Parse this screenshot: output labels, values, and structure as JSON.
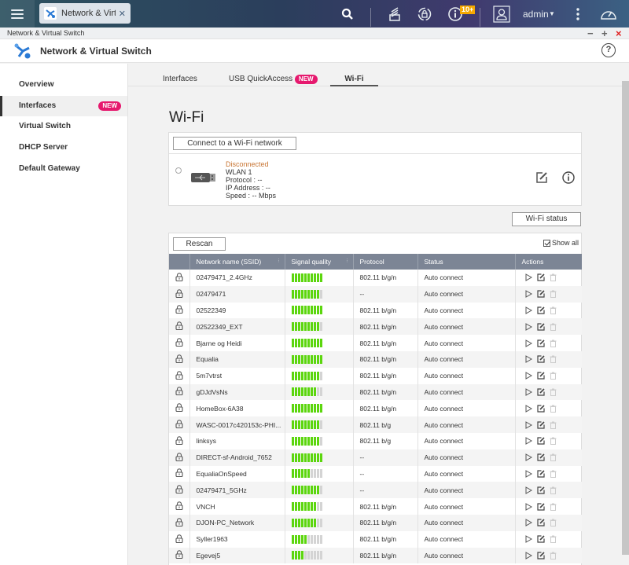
{
  "topbar": {
    "app_tab_title": "Network & Virtu...",
    "notification_badge": "10+",
    "user": "admin"
  },
  "window": {
    "title": "Network & Virtual Switch",
    "controls": {
      "minimize": "−",
      "maximize": "+",
      "close": "×"
    }
  },
  "app_header": {
    "title": "Network & Virtual Switch",
    "help": "?"
  },
  "colors": {
    "accent_new": "#e6196e",
    "signal_on": "#5cd60e",
    "signal_off": "#d4d4d4",
    "disconnected": "#c87533",
    "header_bg": "#7c8595",
    "badge": "#f5a800"
  },
  "sidebar": {
    "items": [
      {
        "label": "Overview"
      },
      {
        "label": "Interfaces",
        "badge": "NEW",
        "active": true
      },
      {
        "label": "Virtual Switch"
      },
      {
        "label": "DHCP Server"
      },
      {
        "label": "Default Gateway"
      }
    ]
  },
  "tabs": [
    {
      "label": "Interfaces"
    },
    {
      "label": "USB QuickAccess",
      "badge": "NEW"
    },
    {
      "label": "Wi-Fi",
      "active": true
    }
  ],
  "wifi": {
    "title": "Wi-Fi",
    "connect_button": "Connect to a Wi-Fi network",
    "adapter": {
      "status": "Disconnected",
      "name": "WLAN 1",
      "protocol": "Protocol : --",
      "ip": "IP Address : --",
      "speed": "Speed : -- Mbps"
    },
    "status_button": "Wi-Fi status",
    "rescan_button": "Rescan",
    "show_all_label": "Show all",
    "show_all_checked": true
  },
  "table": {
    "headers": [
      "",
      "Network name (SSID)",
      "Signal quality",
      "Protocol",
      "Status",
      "Actions"
    ],
    "signal_max": 10,
    "rows": [
      {
        "ssid": "02479471_2.4GHz",
        "signal": 10,
        "protocol": "802.11 b/g/n",
        "status": "Auto connect"
      },
      {
        "ssid": "02479471",
        "signal": 9,
        "protocol": "--",
        "status": "Auto connect"
      },
      {
        "ssid": "02522349",
        "signal": 10,
        "protocol": "802.11 b/g/n",
        "status": "Auto connect"
      },
      {
        "ssid": "02522349_EXT",
        "signal": 9,
        "protocol": "802.11 b/g/n",
        "status": "Auto connect"
      },
      {
        "ssid": "Bjarne og Heidi",
        "signal": 10,
        "protocol": "802.11 b/g/n",
        "status": "Auto connect"
      },
      {
        "ssid": "Equalia",
        "signal": 10,
        "protocol": "802.11 b/g/n",
        "status": "Auto connect"
      },
      {
        "ssid": "5m7vtrst",
        "signal": 9,
        "protocol": "802.11 b/g/n",
        "status": "Auto connect"
      },
      {
        "ssid": "gDJdVsNs",
        "signal": 8,
        "protocol": "802.11 b/g/n",
        "status": "Auto connect"
      },
      {
        "ssid": "HomeBox-6A38",
        "signal": 10,
        "protocol": "802.11 b/g/n",
        "status": "Auto connect"
      },
      {
        "ssid": "WASC-0017c420153c-PHI...",
        "signal": 9,
        "protocol": "802.11 b/g",
        "status": "Auto connect"
      },
      {
        "ssid": "linksys",
        "signal": 9,
        "protocol": "802.11 b/g",
        "status": "Auto connect"
      },
      {
        "ssid": "DIRECT-sf-Android_7652",
        "signal": 10,
        "protocol": "--",
        "status": "Auto connect"
      },
      {
        "ssid": "EqualiaOnSpeed",
        "signal": 6,
        "protocol": "--",
        "status": "Auto connect"
      },
      {
        "ssid": "02479471_5GHz",
        "signal": 9,
        "protocol": "--",
        "status": "Auto connect"
      },
      {
        "ssid": "VNCH",
        "signal": 8,
        "protocol": "802.11 b/g/n",
        "status": "Auto connect"
      },
      {
        "ssid": "DJON-PC_Network",
        "signal": 8,
        "protocol": "802.11 b/g/n",
        "status": "Auto connect"
      },
      {
        "ssid": "Syller1963",
        "signal": 5,
        "protocol": "802.11 b/g/n",
        "status": "Auto connect"
      },
      {
        "ssid": "Egevej5",
        "signal": 4,
        "protocol": "802.11 b/g/n",
        "status": "Auto connect"
      }
    ]
  }
}
